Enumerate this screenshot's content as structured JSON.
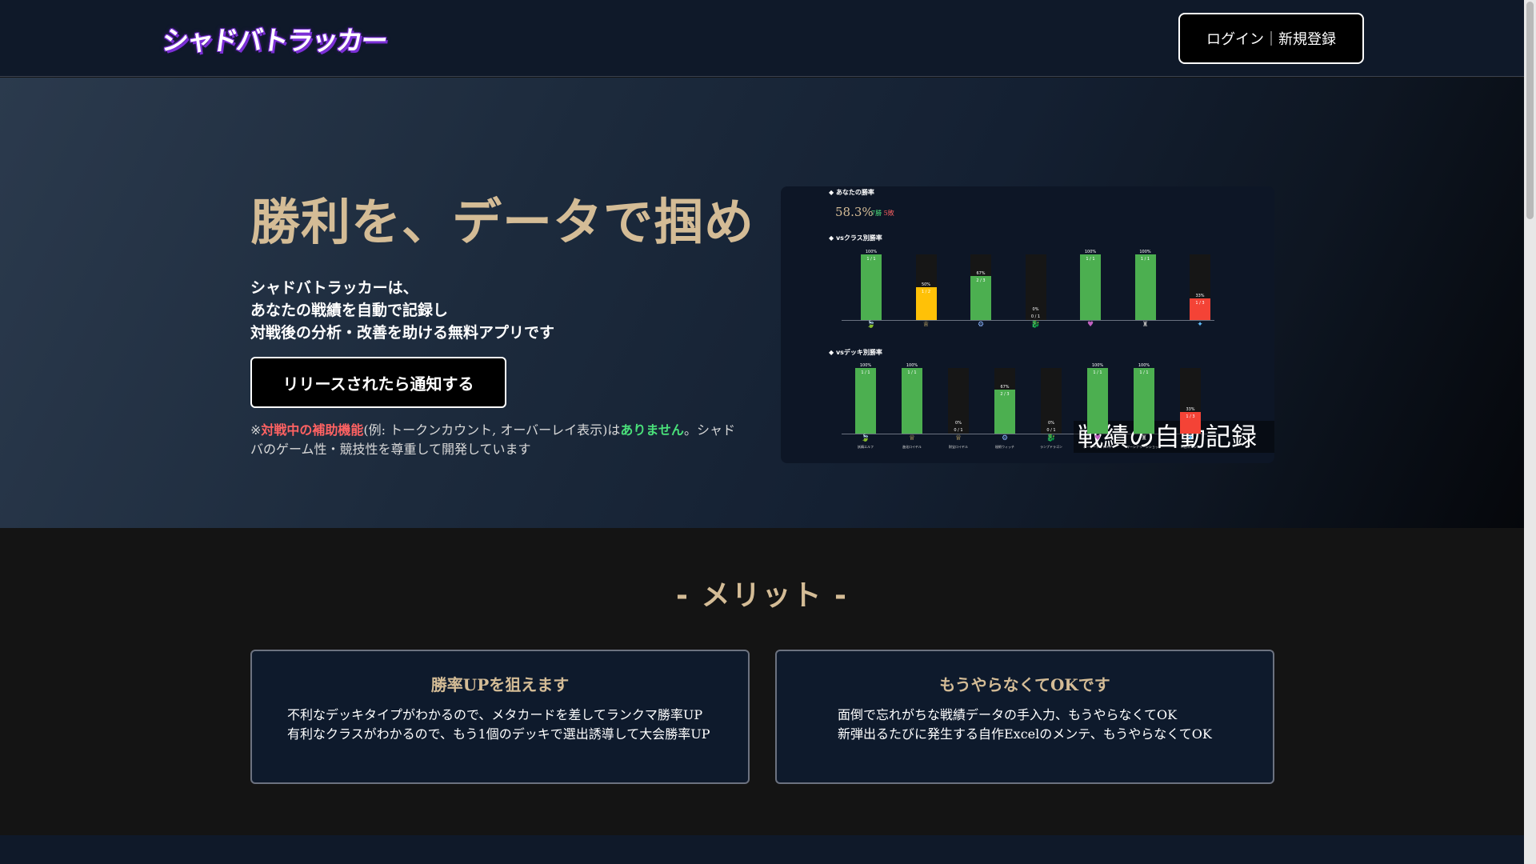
{
  "header": {
    "logo_text": "シャドバトラッカー",
    "login_label": "ログイン｜新規登録"
  },
  "hero": {
    "title": "勝利を、データで掴め",
    "description_lines": [
      "シャドバトラッカーは、",
      "あなたの戦績を自動で記録し",
      "対戦後の分析・改善を助ける無料アプリです"
    ],
    "notify_label": "リリースされたら通知する",
    "note": {
      "prefix": "※",
      "red_text": "対戦中の補助機能",
      "middle": "(例: トークンカウント, オーバーレイ表示)は",
      "green_text": "ありません",
      "suffix": "。シャドバのゲーム性・競技性を尊重して開発しています"
    }
  },
  "preview": {
    "section1_label": "◆ あなたの勝率",
    "overall_rate": "58.3%",
    "wins": "7勝",
    "losses": "5敗",
    "section2_label": "◆ vsクラス別勝率",
    "section3_label": "◆ vsデッキ別勝率",
    "caption": "戦績の自動記録",
    "class_bars": [
      {
        "pct": "100%",
        "wl": "1 / 1",
        "value": 1.0,
        "color": "#4caf50",
        "icon": "🍃",
        "icon_color": "#6ccf6c"
      },
      {
        "pct": "50%",
        "wl": "1 / 2",
        "value": 0.5,
        "color": "#ffc107",
        "icon": "♕",
        "icon_color": "#e0c070"
      },
      {
        "pct": "67%",
        "wl": "2 / 3",
        "value": 0.67,
        "color": "#4caf50",
        "icon": "⚙",
        "icon_color": "#8ab4ff"
      },
      {
        "pct": "0%",
        "wl": "0 / 1",
        "value": 0.0,
        "color": "#ff4444",
        "icon": "🐉",
        "icon_color": "#e09040"
      },
      {
        "pct": "100%",
        "wl": "1 / 1",
        "value": 1.0,
        "color": "#4caf50",
        "icon": "♥",
        "icon_color": "#c060c0"
      },
      {
        "pct": "100%",
        "wl": "1 / 1",
        "value": 1.0,
        "color": "#4caf50",
        "icon": "♜",
        "icon_color": "#b0b0b0"
      },
      {
        "pct": "33%",
        "wl": "1 / 3",
        "value": 0.33,
        "color": "#f44336",
        "icon": "✦",
        "icon_color": "#60c0ff"
      }
    ],
    "deck_bars": [
      {
        "pct": "100%",
        "wl": "1 / 1",
        "value": 1.0,
        "color": "#4caf50",
        "icon": "🍃",
        "icon_color": "#6ccf6c",
        "name": "妖精エルフ"
      },
      {
        "pct": "100%",
        "wl": "1 / 1",
        "value": 1.0,
        "color": "#4caf50",
        "icon": "♕",
        "icon_color": "#e0c070",
        "name": "進化ロイヤル"
      },
      {
        "pct": "0%",
        "wl": "0 / 1",
        "value": 0.0,
        "color": "#ff4444",
        "icon": "♕",
        "icon_color": "#e0c070",
        "name": "財宝ロイヤル"
      },
      {
        "pct": "67%",
        "wl": "2 / 3",
        "value": 0.67,
        "color": "#4caf50",
        "icon": "⚙",
        "icon_color": "#8ab4ff",
        "name": "秘術ウィッチ"
      },
      {
        "pct": "0%",
        "wl": "0 / 1",
        "value": 0.0,
        "color": "#ff4444",
        "icon": "🐉",
        "icon_color": "#e09040",
        "name": "ランプドラゴン"
      },
      {
        "pct": "100%",
        "wl": "1 / 1",
        "value": 1.0,
        "color": "#4caf50",
        "icon": "♥",
        "icon_color": "#c060c0",
        "name": "ホーリーナイトメア"
      },
      {
        "pct": "100%",
        "wl": "1 / 1",
        "value": 1.0,
        "color": "#4caf50",
        "icon": "♜",
        "icon_color": "#b0b0b0",
        "name": "マーシナリーシショップ"
      },
      {
        "pct": "33%",
        "wl": "1 / 3",
        "value": 0.33,
        "color": "#f44336",
        "icon": "✦",
        "icon_color": "#60c0ff",
        "name": "人形ネメシス"
      }
    ]
  },
  "merit": {
    "title": "- メリット -",
    "cards": [
      {
        "title": "勝率UPを狙えます",
        "lines": [
          "不利なデッキタイプがわかるので、メタカードを差してランクマ勝率UP",
          "有利なクラスがわかるので、もう1個のデッキで選出誘導して大会勝率UP"
        ]
      },
      {
        "title": "もうやらなくてOKです",
        "lines": [
          "面倒で忘れがちな戦績データの手入力、もうやらなくてOK",
          "新弾出るたびに発生する自作Excelのメンテ、もうやらなくてOK"
        ]
      }
    ]
  }
}
